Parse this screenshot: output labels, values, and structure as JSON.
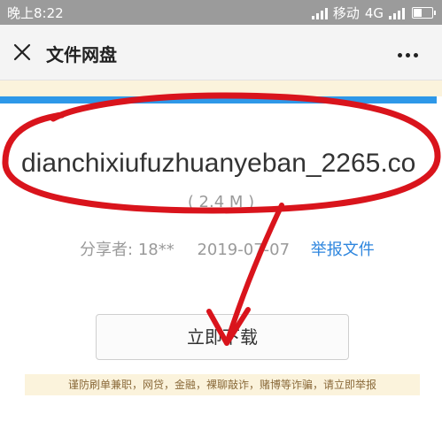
{
  "status_bar": {
    "time": "晚上8:22",
    "carrier": "移动",
    "network": "4G"
  },
  "header": {
    "title": "文件网盘",
    "close_icon": "close-icon",
    "more_icon": "more-dots-icon"
  },
  "download_progress": 0.99,
  "file": {
    "name": "dianchixiufuzhuanyeban_2265.co",
    "size": "( 2.4 M )",
    "sharer_label": "分享者:",
    "sharer": "18**",
    "date": "2019-07-07",
    "report_label": "举报文件"
  },
  "download_button": {
    "label": "立即下载"
  },
  "warning": {
    "text": "谨防刷单兼职，网贷，金融，裸聊敲诈，赌博等诈骗，请立即举报"
  },
  "annotation": {
    "color": "#d9141c"
  }
}
